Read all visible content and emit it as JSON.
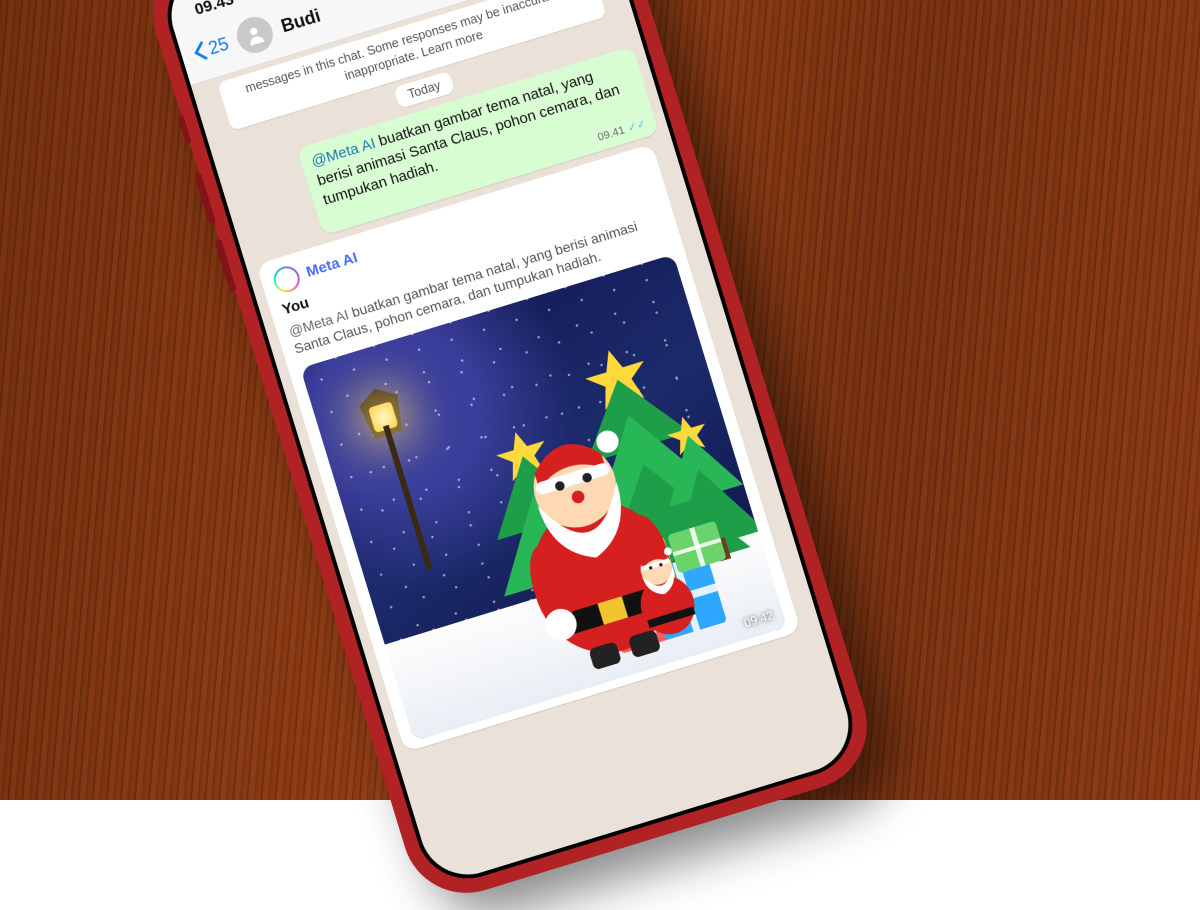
{
  "status": {
    "time": "09.43",
    "airplane": true
  },
  "header": {
    "back_count": "25",
    "contact_name": "Budi"
  },
  "chat": {
    "system_notice": "messages in this chat. Some responses may be inaccurate or inappropriate. Learn more",
    "date_label": "Today",
    "outgoing": {
      "mention": "@Meta AI",
      "text": " buatkan gambar tema natal, yang berisi animasi Santa Claus, pohon cemara, dan tumpukan hadiah.",
      "time": "09.41"
    },
    "incoming": {
      "sender": "Meta AI",
      "you_label": "You",
      "quoted_mention": "@Meta AI",
      "quoted_text": " buatkan gambar tema natal, yang berisi animasi Santa Claus, pohon cemara, dan tumpukan hadiah.",
      "image_time": "09.42"
    }
  }
}
